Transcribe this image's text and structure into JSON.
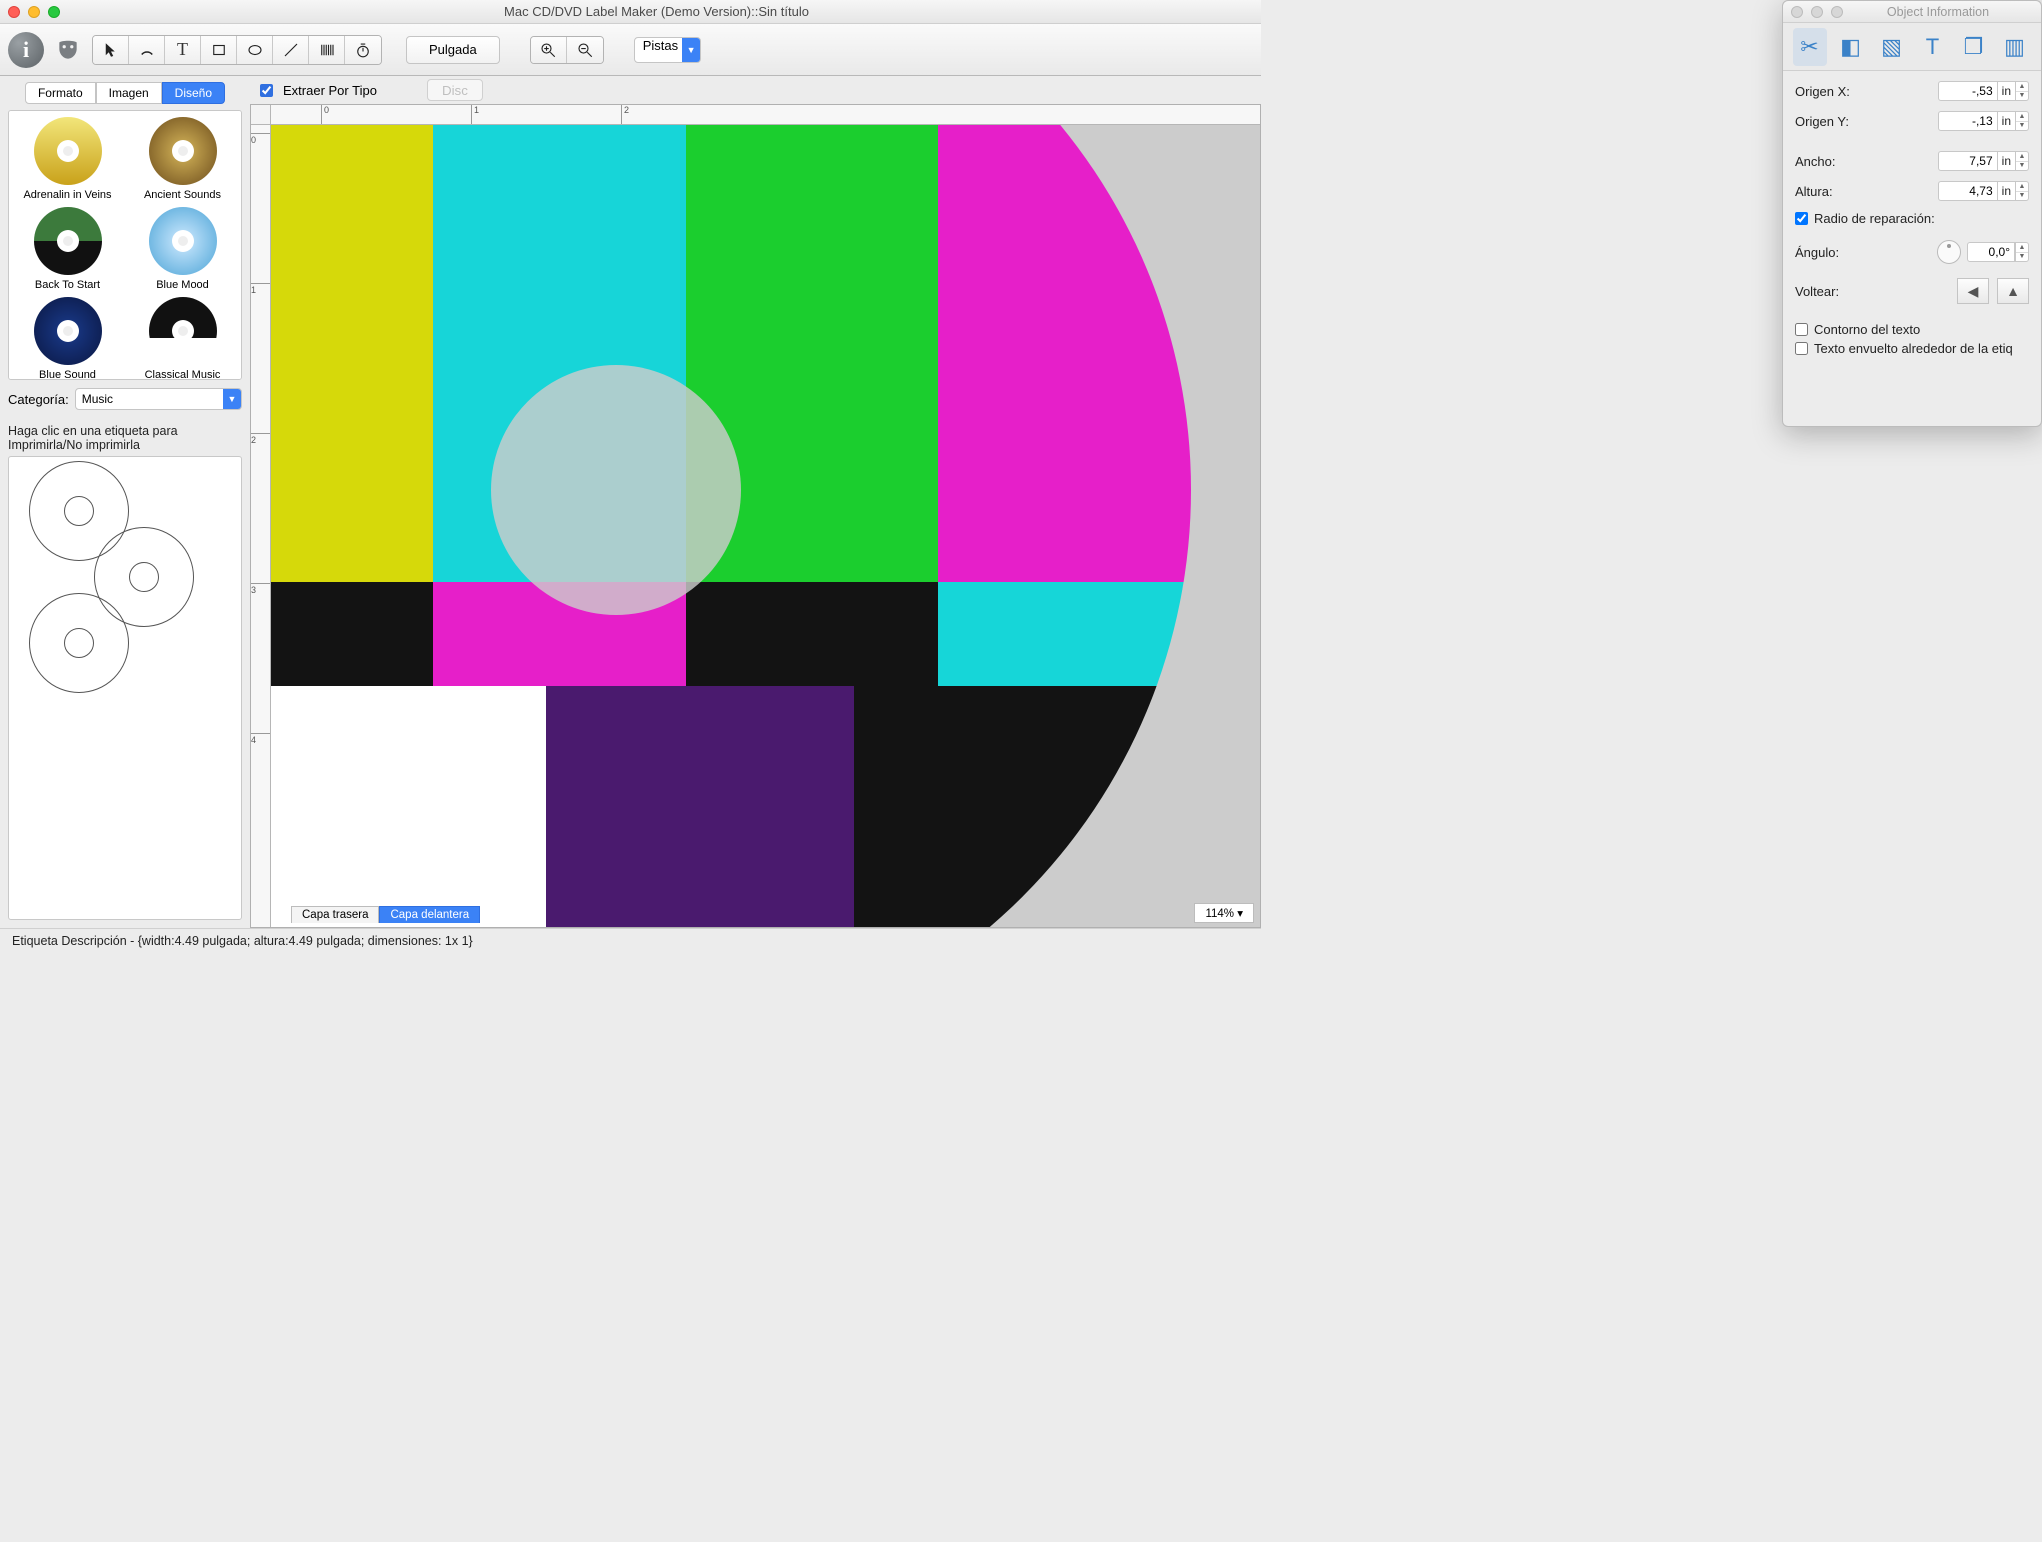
{
  "window": {
    "title": "Mac CD/DVD Label Maker (Demo Version)::Sin título"
  },
  "toolbar": {
    "unit_label": "Pulgada",
    "tracks_label": "Pistas"
  },
  "sidebar": {
    "tabs": {
      "formato": "Formato",
      "imagen": "Imagen",
      "diseno": "Diseño"
    },
    "designs": [
      {
        "label": "Adrenalin in Veins",
        "bg": "linear-gradient(#f2e67a,#c9a21a)"
      },
      {
        "label": "Ancient Sounds",
        "bg": "radial-gradient(circle,#d6b65a,#6a4a1a)"
      },
      {
        "label": "Back To Start",
        "bg": "linear-gradient(#3c7a3c 50%,#111 50%)"
      },
      {
        "label": "Blue Mood",
        "bg": "radial-gradient(circle,#cfeaff,#4aa3d6)"
      },
      {
        "label": "Blue Sound",
        "bg": "radial-gradient(circle,#1a3b8c,#0a1640)"
      },
      {
        "label": "Classical Music",
        "bg": "linear-gradient(#111 60%,#fff 60%)"
      }
    ],
    "category_label": "Categoría:",
    "category_value": "Music",
    "print_hint": "Haga clic en una etiqueta para Imprimirla/No imprimirla"
  },
  "canvas": {
    "extract_label": "Extraer Por Tipo",
    "disc_btn": "Disc",
    "layers": {
      "back": "Capa trasera",
      "front": "Capa delantera"
    },
    "ruler_h": [
      "0",
      "1",
      "2"
    ],
    "ruler_v": [
      "0",
      "1",
      "2",
      "3",
      "4"
    ],
    "zoom": "114%  ▾"
  },
  "inspector": {
    "title": "Object Information",
    "origin_x_label": "Origen X:",
    "origin_y_label": "Origen Y:",
    "width_label": "Ancho:",
    "height_label": "Altura:",
    "ratio_label": "Radio de reparación:",
    "angle_label": "Ángulo:",
    "flip_label": "Voltear:",
    "outline_label": "Contorno del texto",
    "wrap_label": "Texto envuelto alrededor de la etiq",
    "unit": "in",
    "origin_x": "-,53",
    "origin_y": "-,13",
    "width": "7,57",
    "height": "4,73",
    "angle": "0,0°"
  },
  "status": {
    "text": "Etiqueta Descripción - {width:4.49 pulgada; altura:4.49 pulgada; dimensiones: 1x 1}"
  }
}
